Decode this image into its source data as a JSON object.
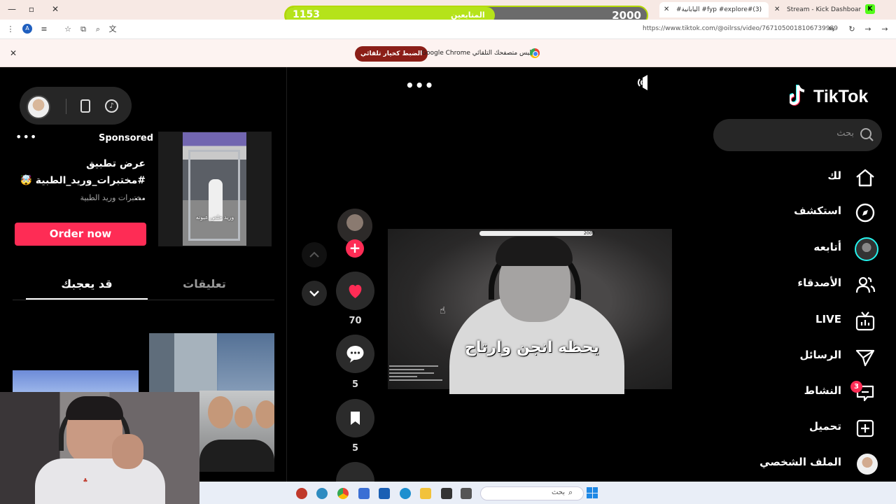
{
  "browser": {
    "tabs": [
      {
        "title": "#اليابانية #fyp #explore#(3)",
        "active": true
      },
      {
        "title": "Stream - Kick Dashboard",
        "active": false
      }
    ],
    "url": "https://www.tiktok.com/@oilrss/video/7671050018106739989",
    "profile_initial": "A",
    "kick_icon": "K",
    "infobar": {
      "message": "Google Chrome ليس متصفحك التلقائي.",
      "button_label": "الضبط كخيار تلقائي"
    }
  },
  "stream_goal": {
    "current": "1153",
    "target": "2000",
    "label": "المتابعين",
    "progress": 0.58,
    "colors": {
      "fill": "#b5e31a",
      "track": "#6b6b6b"
    }
  },
  "left_panel": {
    "ad": {
      "sponsored_label": "Sponsored",
      "title": "عرض تطبيق #مختبرات_وريد_الطبية 🤯 ...",
      "advertiser": "مختبرات وريد الطبية",
      "thumb_caption": "وريد خلص عيونه",
      "cta_label": "Order now"
    },
    "tabs": [
      {
        "label": "قد يعجبك",
        "active": true
      },
      {
        "label": "تعليقات",
        "active": false
      }
    ]
  },
  "video": {
    "caption": "يحظه انجن وارتاح",
    "overlay_value": "2000",
    "actions": {
      "likes": "70",
      "comments": "5",
      "saves": "5"
    }
  },
  "sidebar": {
    "logo": "TikTok",
    "search_placeholder": "بحث",
    "items": [
      {
        "label": "لك",
        "icon": "home-icon"
      },
      {
        "label": "استكشف",
        "icon": "compass-icon"
      },
      {
        "label": "أتابعه",
        "icon": "following-avatar-icon"
      },
      {
        "label": "الأصدقاء",
        "icon": "friends-icon"
      },
      {
        "label": "LIVE",
        "icon": "live-tv-icon"
      },
      {
        "label": "الرسائل",
        "icon": "send-icon"
      },
      {
        "label": "النشاط",
        "icon": "activity-icon",
        "badge": "3"
      },
      {
        "label": "تحميل",
        "icon": "upload-plus-icon"
      },
      {
        "label": "الملف الشخصي",
        "icon": "profile-avatar-icon"
      }
    ]
  },
  "taskbar": {
    "search_label": "بحث"
  },
  "colors": {
    "tiktok_red": "#fe2c55",
    "tiktok_cyan": "#25f4ee",
    "background": "#000000"
  }
}
